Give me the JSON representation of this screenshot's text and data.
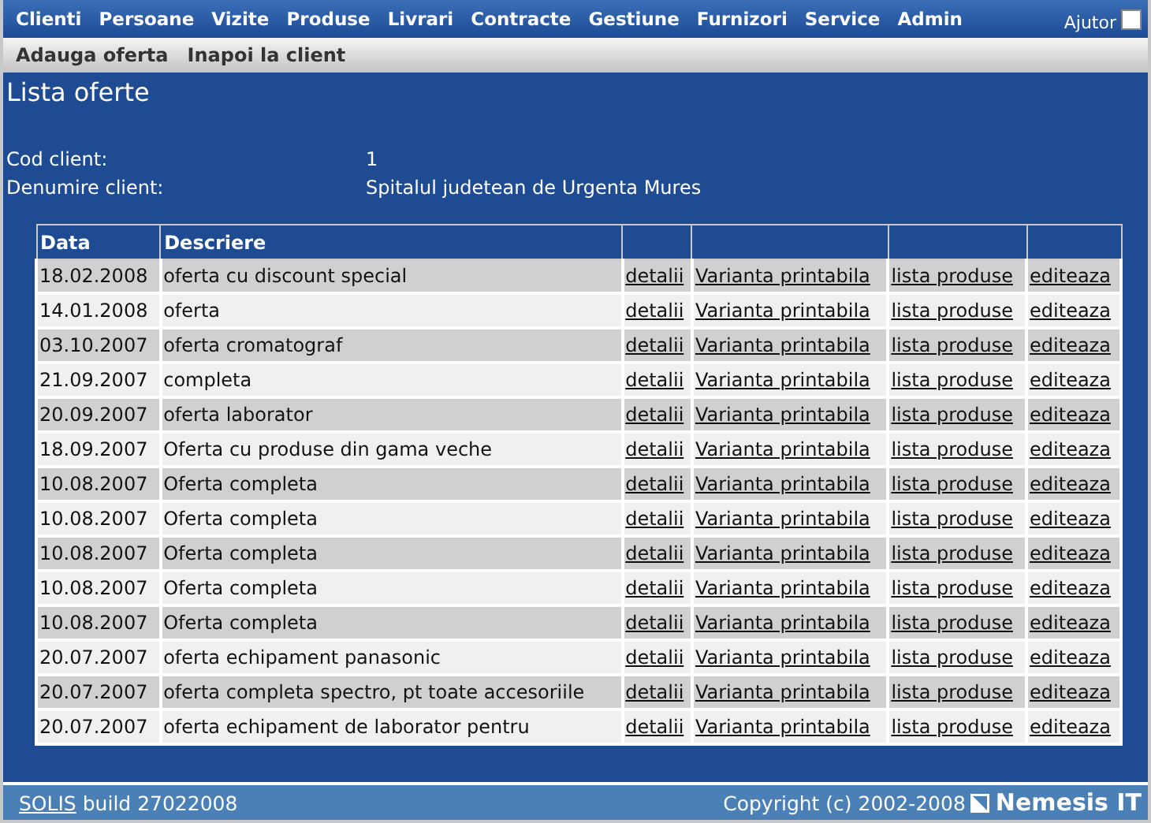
{
  "menu": [
    {
      "label": "Clienti"
    },
    {
      "label": "Persoane"
    },
    {
      "label": "Vizite"
    },
    {
      "label": "Produse"
    },
    {
      "label": "Livrari"
    },
    {
      "label": "Contracte"
    },
    {
      "label": "Gestiune"
    },
    {
      "label": "Furnizori"
    },
    {
      "label": "Service"
    },
    {
      "label": "Admin"
    }
  ],
  "help": {
    "label": "Ajutor",
    "checked": false
  },
  "actions": [
    {
      "label": "Adauga oferta"
    },
    {
      "label": "Inapoi la client"
    }
  ],
  "page_title": "Lista oferte",
  "client": [
    {
      "label": "Cod client:",
      "value": "1"
    },
    {
      "label": "Denumire client:",
      "value": "Spitalul judetean de Urgenta Mures"
    }
  ],
  "table": {
    "columns": [
      "Data",
      "Descriere"
    ],
    "rows": [
      {
        "date": "18.02.2008",
        "description": "oferta cu discount special",
        "links": [
          "detalii",
          "Varianta printabila",
          "lista produse",
          "editeaza"
        ]
      },
      {
        "date": "14.01.2008",
        "description": "oferta",
        "links": [
          "detalii",
          "Varianta printabila",
          "lista produse",
          "editeaza"
        ]
      },
      {
        "date": "03.10.2007",
        "description": "oferta cromatograf",
        "links": [
          "detalii",
          "Varianta printabila",
          "lista produse",
          "editeaza"
        ]
      },
      {
        "date": "21.09.2007",
        "description": "completa",
        "links": [
          "detalii",
          "Varianta printabila",
          "lista produse",
          "editeaza"
        ]
      },
      {
        "date": "20.09.2007",
        "description": "oferta laborator",
        "links": [
          "detalii",
          "Varianta printabila",
          "lista produse",
          "editeaza"
        ]
      },
      {
        "date": "18.09.2007",
        "description": "Oferta cu produse din gama veche",
        "links": [
          "detalii",
          "Varianta printabila",
          "lista produse",
          "editeaza"
        ]
      },
      {
        "date": "10.08.2007",
        "description": "Oferta completa",
        "links": [
          "detalii",
          "Varianta printabila",
          "lista produse",
          "editeaza"
        ]
      },
      {
        "date": "10.08.2007",
        "description": "Oferta completa",
        "links": [
          "detalii",
          "Varianta printabila",
          "lista produse",
          "editeaza"
        ]
      },
      {
        "date": "10.08.2007",
        "description": "Oferta completa",
        "links": [
          "detalii",
          "Varianta printabila",
          "lista produse",
          "editeaza"
        ]
      },
      {
        "date": "10.08.2007",
        "description": "Oferta completa",
        "links": [
          "detalii",
          "Varianta printabila",
          "lista produse",
          "editeaza"
        ]
      },
      {
        "date": "10.08.2007",
        "description": "Oferta completa",
        "links": [
          "detalii",
          "Varianta printabila",
          "lista produse",
          "editeaza"
        ]
      },
      {
        "date": "20.07.2007",
        "description": "oferta echipament panasonic",
        "links": [
          "detalii",
          "Varianta printabila",
          "lista produse",
          "editeaza"
        ]
      },
      {
        "date": "20.07.2007",
        "description": "oferta completa spectro, pt toate accesoriile",
        "links": [
          "detalii",
          "Varianta printabila",
          "lista produse",
          "editeaza"
        ]
      },
      {
        "date": "20.07.2007",
        "description": "oferta echipament de laborator pentru",
        "links": [
          "detalii",
          "Varianta printabila",
          "lista produse",
          "editeaza"
        ]
      }
    ]
  },
  "footer": {
    "app_link": "SOLIS",
    "build": "build 27022008",
    "copyright": "Copyright (c) 2002-2008",
    "brand": "Nemesis IT"
  }
}
